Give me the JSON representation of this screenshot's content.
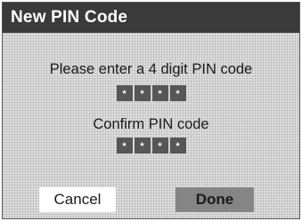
{
  "dialog": {
    "title": "New PIN Code",
    "enter_prompt": "Please enter a 4 digit PIN code",
    "confirm_prompt": "Confirm PIN code",
    "pin_entry": [
      "*",
      "*",
      "*",
      "*"
    ],
    "pin_confirm": [
      "*",
      "*",
      "*",
      "*"
    ],
    "cancel_label": "Cancel",
    "done_label": "Done"
  }
}
